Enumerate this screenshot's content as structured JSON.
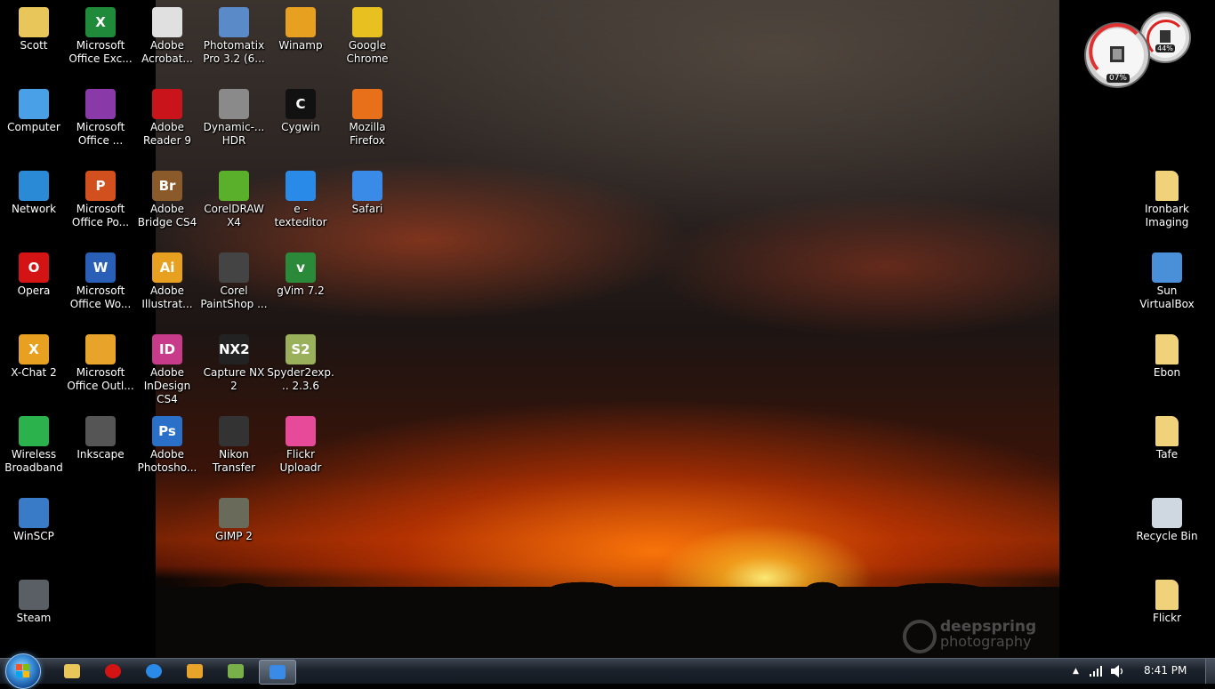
{
  "desktop": {
    "left_icons": [
      {
        "label": "Scott",
        "glyph": "",
        "icon": "user-folder-icon",
        "color": "#e8c65a"
      },
      {
        "label": "Computer",
        "glyph": "",
        "icon": "computer-icon",
        "color": "#4aa0e6"
      },
      {
        "label": "Network",
        "glyph": "",
        "icon": "network-globe-icon",
        "color": "#2b8ad6"
      },
      {
        "label": "Opera",
        "glyph": "O",
        "icon": "opera-icon",
        "color": "#d41414"
      },
      {
        "label": "X-Chat 2",
        "glyph": "X",
        "icon": "xchat-icon",
        "color": "#e8a020"
      },
      {
        "label": "Wireless Broadband",
        "glyph": "",
        "icon": "wireless-broadband-icon",
        "color": "#2bb24c"
      },
      {
        "label": "WinSCP",
        "glyph": "",
        "icon": "winscp-icon",
        "color": "#3a7bc8"
      },
      {
        "label": "Steam",
        "glyph": "",
        "icon": "steam-icon",
        "color": "#5a5f66"
      },
      {
        "label": "Microsoft Office Exc...",
        "glyph": "X",
        "icon": "excel-icon",
        "color": "#1f8a3a"
      },
      {
        "label": "Microsoft Office ...",
        "glyph": "",
        "icon": "onenote-icon",
        "color": "#8a3aa8"
      },
      {
        "label": "Microsoft Office Po...",
        "glyph": "P",
        "icon": "powerpoint-icon",
        "color": "#d2501e"
      },
      {
        "label": "Microsoft Office Wo...",
        "glyph": "W",
        "icon": "word-icon",
        "color": "#2a5fb8"
      },
      {
        "label": "Microsoft Office Outl...",
        "glyph": "",
        "icon": "outlook-icon",
        "color": "#e8a32a"
      },
      {
        "label": "Inkscape",
        "glyph": "",
        "icon": "inkscape-icon",
        "color": "#555"
      },
      {
        "label": "Adobe Acrobat...",
        "glyph": "",
        "icon": "acrobat-icon",
        "color": "#e0e0e0"
      },
      {
        "label": "Adobe Reader 9",
        "glyph": "",
        "icon": "adobe-reader-icon",
        "color": "#c8141a"
      },
      {
        "label": "Adobe Bridge CS4",
        "glyph": "Br",
        "icon": "adobe-bridge-icon",
        "color": "#8a5a2a"
      },
      {
        "label": "Adobe Illustrat...",
        "glyph": "Ai",
        "icon": "adobe-illustrator-icon",
        "color": "#e8a020"
      },
      {
        "label": "Adobe InDesign CS4",
        "glyph": "ID",
        "icon": "adobe-indesign-icon",
        "color": "#c83a8a"
      },
      {
        "label": "Adobe Photosho...",
        "glyph": "Ps",
        "icon": "adobe-photoshop-icon",
        "color": "#2a70c8"
      },
      {
        "label": "Photomatix Pro 3.2 (6...",
        "glyph": "",
        "icon": "photomatix-icon",
        "color": "#5a8ac8"
      },
      {
        "label": "Dynamic-... HDR",
        "glyph": "",
        "icon": "dynamic-hdr-icon",
        "color": "#8a8a8a"
      },
      {
        "label": "CorelDRAW X4",
        "glyph": "",
        "icon": "coreldraw-icon",
        "color": "#5ab02a"
      },
      {
        "label": "Corel PaintShop ...",
        "glyph": "",
        "icon": "paintshop-icon",
        "color": "#444"
      },
      {
        "label": "Capture NX 2",
        "glyph": "NX2",
        "icon": "capture-nx2-icon",
        "color": "#222"
      },
      {
        "label": "Nikon Transfer",
        "glyph": "",
        "icon": "nikon-transfer-icon",
        "color": "#333"
      },
      {
        "label": "GIMP 2",
        "glyph": "",
        "icon": "gimp-icon",
        "color": "#6a6a5a"
      },
      {
        "label": "Winamp",
        "glyph": "",
        "icon": "winamp-icon",
        "color": "#e8a020"
      },
      {
        "label": "Cygwin",
        "glyph": "C",
        "icon": "cygwin-icon",
        "color": "#111"
      },
      {
        "label": "e - texteditor",
        "glyph": "",
        "icon": "e-texteditor-icon",
        "color": "#2a8ae8"
      },
      {
        "label": "gVim 7.2",
        "glyph": "v",
        "icon": "gvim-icon",
        "color": "#2a8a3a"
      },
      {
        "label": "Spyder2exp... 2.3.6",
        "glyph": "S2",
        "icon": "spyder2-icon",
        "color": "#9ab05a"
      },
      {
        "label": "Flickr Uploadr",
        "glyph": "",
        "icon": "flickr-uploadr-icon",
        "color": "#e84a9a"
      },
      {
        "label": "Google Chrome",
        "glyph": "",
        "icon": "chrome-icon",
        "color": "#e8c020"
      },
      {
        "label": "Mozilla Firefox",
        "glyph": "",
        "icon": "firefox-icon",
        "color": "#e8701a"
      },
      {
        "label": "Safari",
        "glyph": "",
        "icon": "safari-icon",
        "color": "#3a8ae8"
      }
    ],
    "right_icons": [
      {
        "label": "Ironbark Imaging",
        "icon": "folder-icon",
        "color": "#f0d27a"
      },
      {
        "label": "Sun VirtualBox",
        "icon": "virtualbox-icon",
        "color": "#4a90d8"
      },
      {
        "label": "Ebon",
        "icon": "folder-icon",
        "color": "#f0d27a"
      },
      {
        "label": "Tafe",
        "icon": "folder-icon",
        "color": "#f0d27a"
      },
      {
        "label": "Recycle Bin",
        "icon": "recycle-bin-icon",
        "color": "#cfd8e0"
      },
      {
        "label": "Flickr",
        "icon": "folder-icon",
        "color": "#f0d27a"
      }
    ],
    "watermark": {
      "line1": "deepspring",
      "line2": "photography"
    }
  },
  "gadget": {
    "cpu": "07%",
    "memory": "44%"
  },
  "taskbar": {
    "pinned": [
      {
        "name": "explorer",
        "icon": "folder-icon",
        "color": "#e8c65a"
      },
      {
        "name": "opera",
        "icon": "opera-icon",
        "color": "#d41414"
      },
      {
        "name": "internet-explorer",
        "icon": "ie-icon",
        "color": "#2a8ae8"
      },
      {
        "name": "outlook",
        "icon": "outlook-icon",
        "color": "#e8a32a"
      },
      {
        "name": "windows-live",
        "icon": "live-messenger-icon",
        "color": "#7ab04a"
      },
      {
        "name": "network-app",
        "icon": "network-app-icon",
        "color": "#3a8ae8"
      }
    ],
    "clock": "8:41 PM"
  }
}
